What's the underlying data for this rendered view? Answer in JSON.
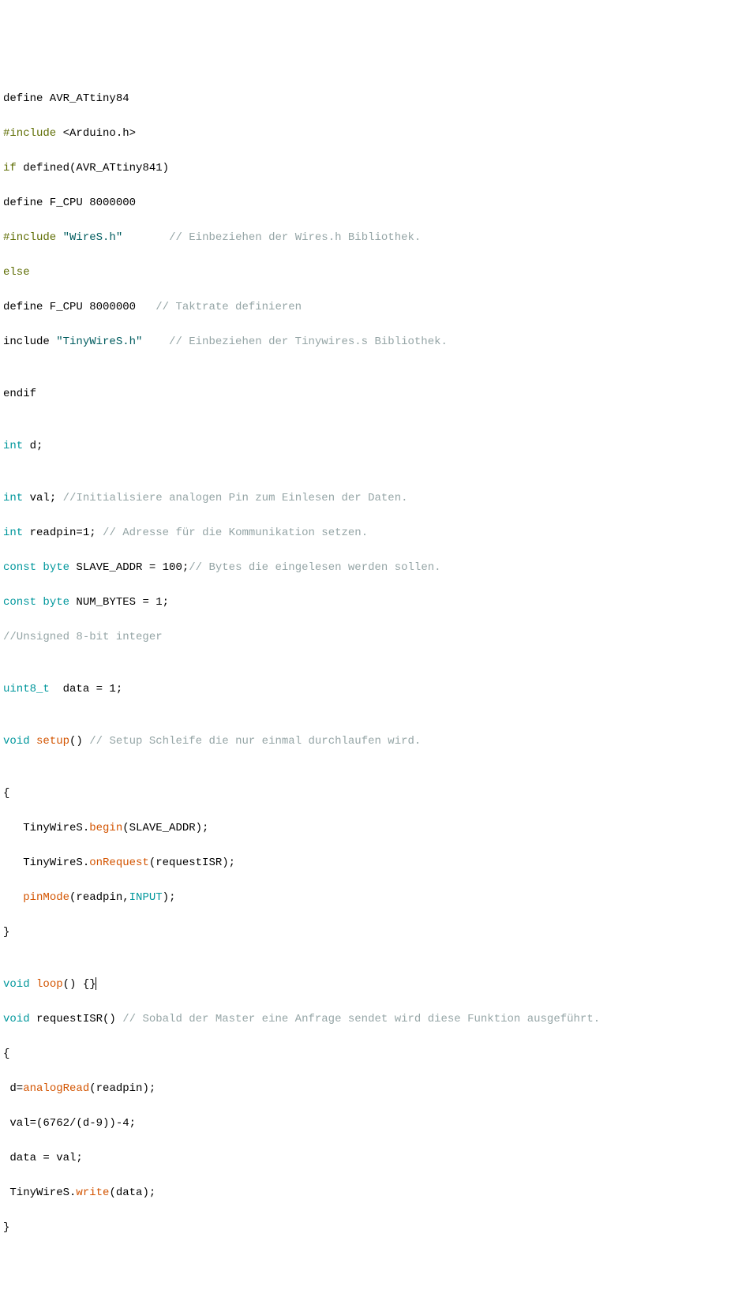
{
  "code": {
    "l1_a": "define AVR_ATtiny84",
    "l2_a": "#include",
    "l2_b": " <Arduino.h>",
    "l3_a": "if",
    "l3_b": " defined(AVR_ATtiny841)",
    "l4_a": "define F_CPU 8000000",
    "l5_a": "#include",
    "l5_b": " ",
    "l5_c": "\"WireS.h\"",
    "l5_d": "       ",
    "l5_e": "// Einbeziehen der Wires.h Bibliothek.",
    "l6_a": "else",
    "l7_a": "define F_CPU 8000000   ",
    "l7_b": "// Taktrate definieren",
    "l8_a": "include ",
    "l8_b": "\"TinyWireS.h\"",
    "l8_c": "    ",
    "l8_d": "// Einbeziehen der Tinywires.s Bibliothek.",
    "l9_a": "",
    "l10_a": "endif",
    "l11_a": "",
    "l12_a": "int",
    "l12_b": " d;",
    "l13_a": "",
    "l14_a": "int",
    "l14_b": " val; ",
    "l14_c": "//Initialisiere analogen Pin zum Einlesen der Daten.",
    "l15_a": "int",
    "l15_b": " readpin=1; ",
    "l15_c": "// Adresse für die Kommunikation setzen.",
    "l16_a": "const",
    "l16_b": " ",
    "l16_c": "byte",
    "l16_d": " SLAVE_ADDR = 100;",
    "l16_e": "// Bytes die eingelesen werden sollen.",
    "l17_a": "const",
    "l17_b": " ",
    "l17_c": "byte",
    "l17_d": " NUM_BYTES = 1;",
    "l18_a": "//Unsigned 8-bit integer",
    "l19_a": "",
    "l20_a": "uint8_t",
    "l20_b": "  data = 1;",
    "l21_a": "",
    "l22_a": "void",
    "l22_b": " ",
    "l22_c": "setup",
    "l22_d": "() ",
    "l22_e": "// Setup Schleife die nur einmal durchlaufen wird.",
    "l23_a": "",
    "l24_a": "{",
    "l25_a": "   TinyWireS.",
    "l25_b": "begin",
    "l25_c": "(SLAVE_ADDR);",
    "l26_a": "   TinyWireS.",
    "l26_b": "onRequest",
    "l26_c": "(requestISR);",
    "l27_a": "   ",
    "l27_b": "pinMode",
    "l27_c": "(readpin,",
    "l27_d": "INPUT",
    "l27_e": ");",
    "l28_a": "}",
    "l29_a": "",
    "l30_a": "void",
    "l30_b": " ",
    "l30_c": "loop",
    "l30_d": "() {}",
    "l31_a": "void",
    "l31_b": " requestISR() ",
    "l31_c": "// Sobald der Master eine Anfrage sendet wird diese Funktion ausgeführt.",
    "l32_a": "{",
    "l33_a": " d=",
    "l33_b": "analogRead",
    "l33_c": "(readpin);",
    "l34_a": " val=(6762/(d-9))-4;",
    "l35_a": " data = val;",
    "l36_a": " TinyWireS.",
    "l36_b": "write",
    "l36_c": "(data);",
    "l37_a": "}"
  }
}
